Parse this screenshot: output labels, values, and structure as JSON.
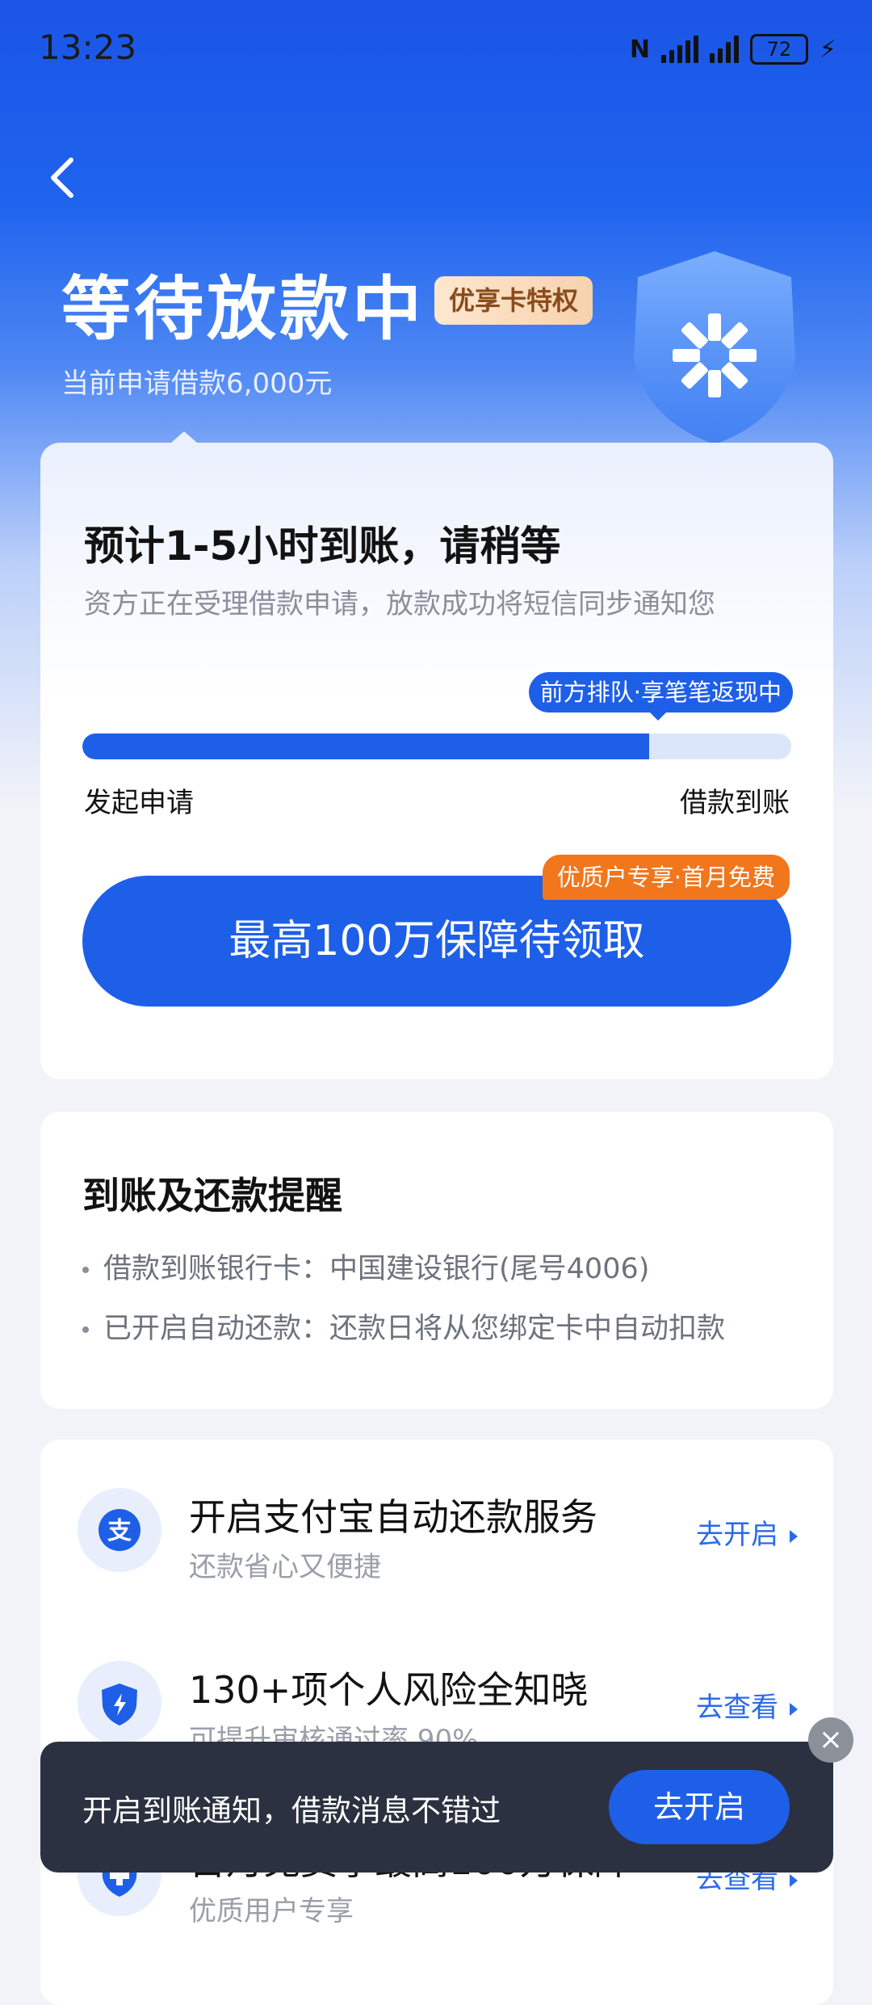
{
  "status_bar": {
    "time": "13:23",
    "battery": "72"
  },
  "header": {
    "title": "等待放款中",
    "badge": "优享卡特权",
    "subtitle": "当前申请借款6,000元"
  },
  "progress_card": {
    "eta": "预计1-5小时到账，请稍等",
    "description": "资方正在受理借款申请，放款成功将短信同步通知您",
    "queue_tag": "前方排队·享笔笔返现中",
    "progress_percent": 80,
    "start_label": "发起申请",
    "end_label": "借款到账",
    "insurance_button": "最高100万保障待领取",
    "promo_tag": "优质户专享·首月免费"
  },
  "reminder_card": {
    "title": "到账及还款提醒",
    "lines": [
      "借款到账银行卡：中国建设银行(尾号4006)",
      "已开启自动还款：还款日将从您绑定卡中自动扣款"
    ]
  },
  "services": [
    {
      "icon": "alipay-icon",
      "title": "开启支付宝自动还款服务",
      "subtitle": "还款省心又便捷",
      "action": "去开启"
    },
    {
      "icon": "shield-bolt-icon",
      "title": "130+项个人风险全知晓",
      "subtitle": "可提升审核通过率 90%",
      "action": "去查看"
    },
    {
      "icon": "shield-plus-icon",
      "title": "首月免费享最高100万保障",
      "subtitle": "优质用户专享",
      "action": "去查看"
    }
  ],
  "toast": {
    "text": "开启到账通知，借款消息不错过",
    "button": "去开启"
  },
  "colors": {
    "primary": "#1e5fe8",
    "promo": "#f2761c",
    "toast_bg": "#2b3140"
  }
}
